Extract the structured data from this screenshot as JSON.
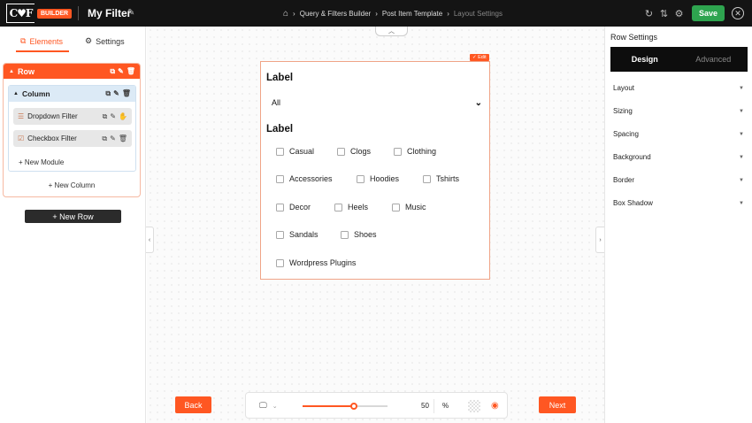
{
  "topbar": {
    "logo_text": "C♥F",
    "logo_badge": "BUILDER",
    "title": "My Filter",
    "breadcrumbs": [
      {
        "label": "Query & Filters Builder"
      },
      {
        "label": "Post Item Template"
      },
      {
        "label": "Layout Settings"
      }
    ],
    "save_label": "Save"
  },
  "left_panel": {
    "tabs": [
      {
        "label": "Elements",
        "active": true
      },
      {
        "label": "Settings",
        "active": false
      }
    ],
    "row_label": "Row",
    "column_label": "Column",
    "modules": [
      {
        "label": "Dropdown Filter"
      },
      {
        "label": "Checkbox Filter"
      }
    ],
    "new_module_label": "+ New Module",
    "new_column_label": "+ New Column",
    "new_row_label": "+ New Row"
  },
  "preview": {
    "edit_label": "✓ Edit",
    "dropdown": {
      "label": "Label",
      "value": "All"
    },
    "checkbox_group": {
      "label": "Label",
      "options": [
        "Casual",
        "Clogs",
        "Clothing",
        "Accessories",
        "Hoodies",
        "Tshirts",
        "Decor",
        "Heels",
        "Music",
        "Sandals",
        "Shoes",
        "Wordpress Plugins"
      ]
    }
  },
  "bottom_bar": {
    "back_label": "Back",
    "next_label": "Next",
    "zoom_value": "50",
    "zoom_unit": "%",
    "zoom_fraction": 0.6,
    "accent_color": "#ff5722"
  },
  "right_panel": {
    "title": "Row Settings",
    "tabs": [
      {
        "label": "Design",
        "active": true
      },
      {
        "label": "Advanced",
        "active": false
      }
    ],
    "sections": [
      "Layout",
      "Sizing",
      "Spacing",
      "Background",
      "Border",
      "Box Shadow"
    ]
  }
}
